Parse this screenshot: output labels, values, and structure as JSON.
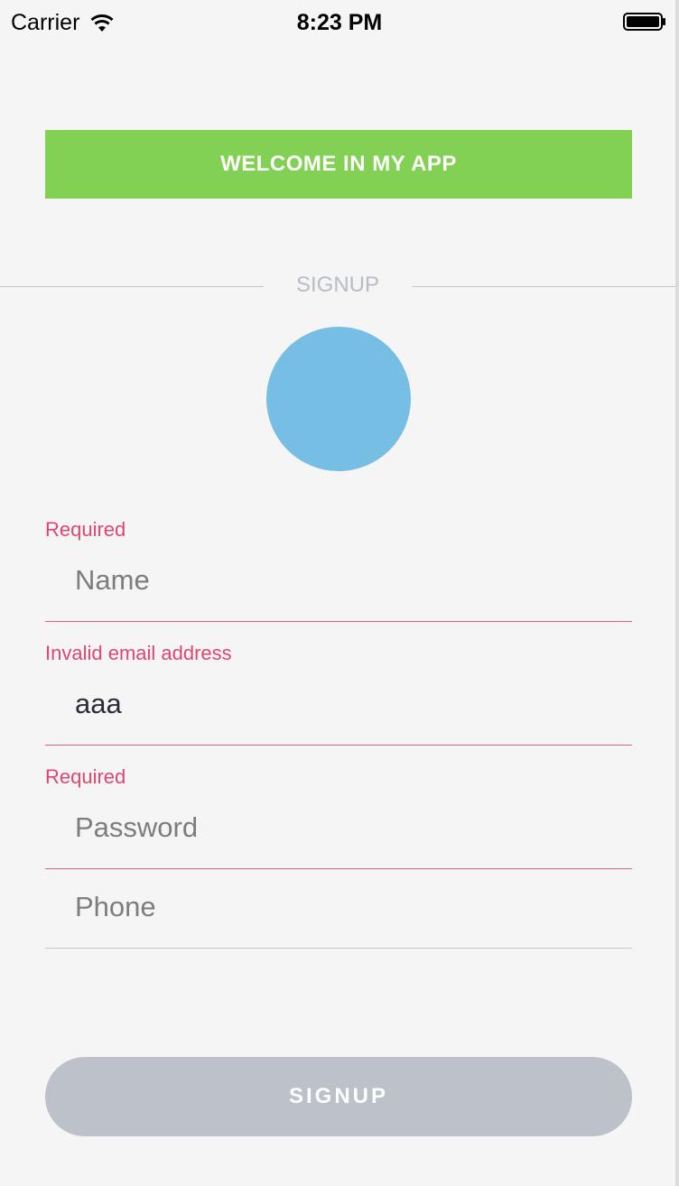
{
  "status_bar": {
    "carrier": "Carrier",
    "time": "8:23 PM",
    "wifi_icon": "wifi-icon",
    "battery_icon": "battery-icon"
  },
  "banner": {
    "text": "WELCOME IN MY APP",
    "color": "#82d154"
  },
  "divider": {
    "label": "SIGNUP"
  },
  "avatar": {
    "color": "#76bee3"
  },
  "form": {
    "name": {
      "error": "Required",
      "value": "",
      "placeholder": "Name"
    },
    "email": {
      "error": "Invalid email address",
      "value": "aaa",
      "placeholder": ""
    },
    "password": {
      "error": "Required",
      "value": "",
      "placeholder": "Password"
    },
    "phone": {
      "value": "",
      "placeholder": "Phone"
    }
  },
  "signup_button": {
    "label": "SIGNUP",
    "color": "#bcc1ca"
  },
  "colors": {
    "error": "#e0466f",
    "background": "#f5f5f5"
  }
}
